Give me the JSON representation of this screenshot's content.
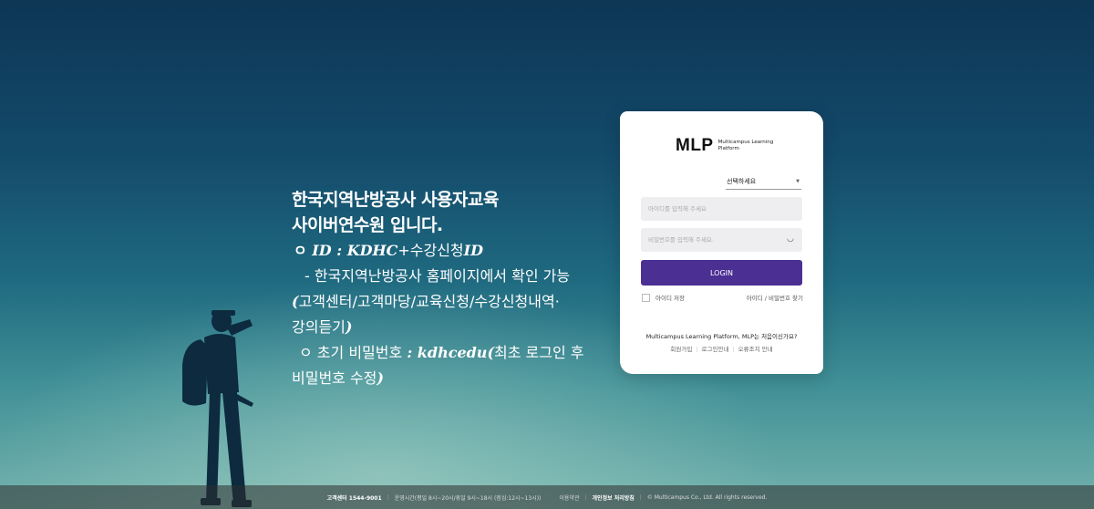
{
  "notice": {
    "line1": "한국지역난방공사 사용자교육",
    "line2": "사이버연수원 입니다.",
    "line3_bullet": "ㅇ ",
    "line3_id_label": "ID : KDHC",
    "line3_plus": "+수강신청",
    "line3_id_suffix": "ID",
    "line4": "- 한국지역난방공사 홈페이지에서 확인 가능",
    "line5_paren": "(",
    "line5": "고객센터/고객마당/교육신청/수강신청내역·",
    "line6": "강의듣기",
    "line6_paren": ")",
    "line7_bullet": "ㅇ 초기 비밀번호 ",
    "line7_pw": ": kdhcedu(",
    "line7_tail": "최초 로그인 후",
    "line8": "비밀번호 수정",
    "line8_paren": ")"
  },
  "login": {
    "logo_text": "MLP",
    "logo_sub": "Multicampus Learning Platform",
    "select_value": "선택하세요",
    "id_placeholder": "아이디를 입력해 주세요",
    "pw_placeholder": "비밀번호를 입력해 주세요.",
    "login_label": "LOGIN",
    "save_id_label": "아이디 저장",
    "find_link": "아이디 / 비밀번호 찾기",
    "first_question": "Multicampus Learning Platform, MLP는 처음이신가요?",
    "links": [
      "회원가입",
      "로그인안내",
      "오류조치 안내"
    ]
  },
  "footer": {
    "phone": "고객센터 1544-9001",
    "hours": "운영시간(평일 8시~20시/휴일 9시~18시 (점심:12시~13시))",
    "terms": "이용약관",
    "privacy": "개인정보 처리방침",
    "copyright": "© Multicampus Co., Ltd. All rights reserved."
  },
  "colors": {
    "accent": "#4b2f93"
  }
}
